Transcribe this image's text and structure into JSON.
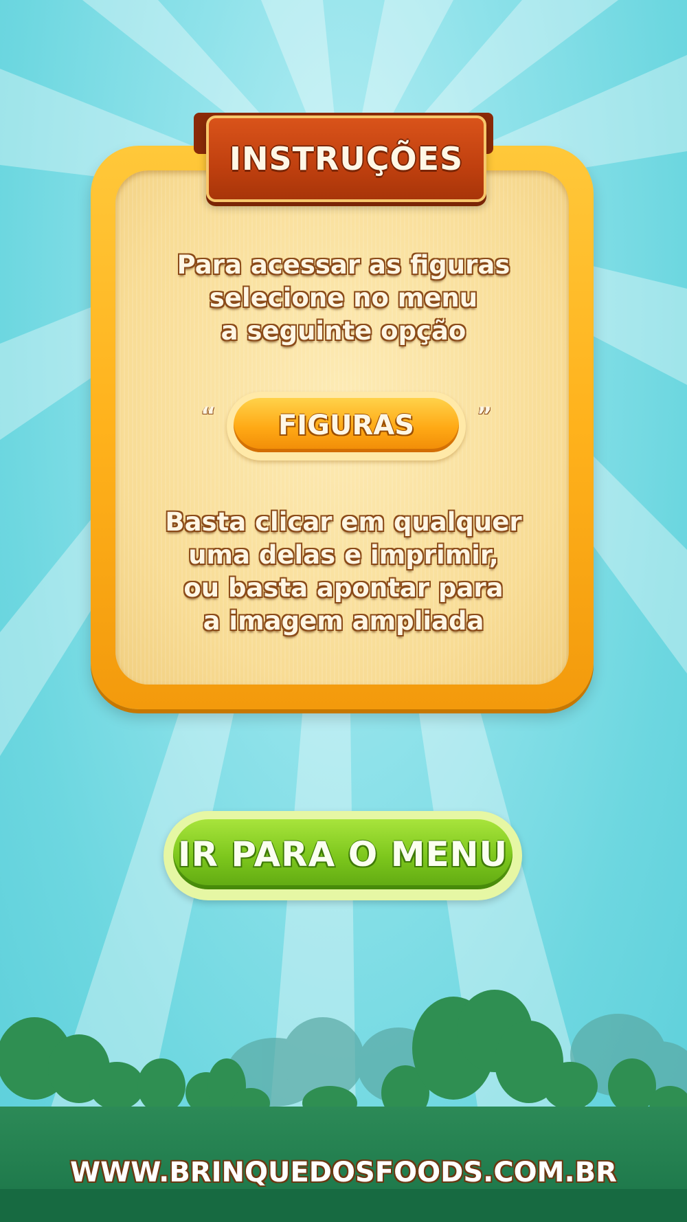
{
  "title": "INSTRUÇÕES",
  "instructions_top": [
    "Para acessar as figuras",
    "selecione no menu",
    "a  seguinte opção"
  ],
  "quote_open": "“",
  "quote_close": "”",
  "figuras_button": "FIGURAS",
  "instructions_bottom": [
    "Basta clicar em qualquer",
    "uma delas e imprimir,",
    "ou basta apontar para",
    "a imagem ampliada"
  ],
  "menu_button": "IR PARA O MENU",
  "site_url": "WWW.BRINQUEDOSFOODS.COM.BR",
  "colors": {
    "sky": "#8fe2ea",
    "panel_frame": "#ffb21c",
    "panel_fill": "#f8dc95",
    "ribbon": "#c0400f",
    "figuras_button": "#ffa915",
    "menu_button": "#7cc61c",
    "ground": "#1f7a4c"
  }
}
